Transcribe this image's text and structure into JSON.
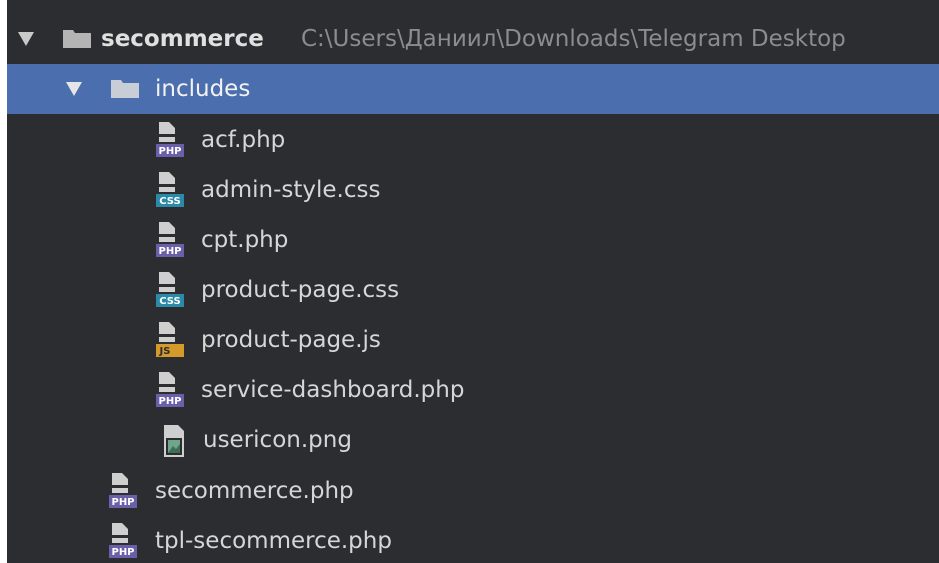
{
  "project_tree": {
    "root": {
      "name": "secommerce",
      "path": "C:\\Users\\Даниил\\Downloads\\Telegram Desktop"
    },
    "includes_folder": {
      "name": "includes"
    },
    "includes_files": [
      {
        "name": "acf.php",
        "type_badge": "PHP",
        "icon": "php-file-icon"
      },
      {
        "name": "admin-style.css",
        "type_badge": "CSS",
        "icon": "css-file-icon"
      },
      {
        "name": "cpt.php",
        "type_badge": "PHP",
        "icon": "php-file-icon"
      },
      {
        "name": "product-page.css",
        "type_badge": "CSS",
        "icon": "css-file-icon"
      },
      {
        "name": "product-page.js",
        "type_badge": "JS",
        "icon": "js-file-icon"
      },
      {
        "name": "service-dashboard.php",
        "type_badge": "PHP",
        "icon": "php-file-icon"
      },
      {
        "name": "usericon.png",
        "icon": "image-file-icon"
      }
    ],
    "root_files": [
      {
        "name": "secommerce.php",
        "type_badge": "PHP",
        "icon": "php-file-icon"
      },
      {
        "name": "tpl-secommerce.php",
        "type_badge": "PHP",
        "icon": "php-file-icon"
      }
    ]
  },
  "colors": {
    "background": "#2b2d30",
    "selection": "#4b6eaf",
    "text": "#d6d6d6",
    "path_text": "#8c8c8c",
    "php_badge": "#6a5fa8",
    "css_badge": "#2a8aa8",
    "js_badge": "#d49a2a"
  }
}
